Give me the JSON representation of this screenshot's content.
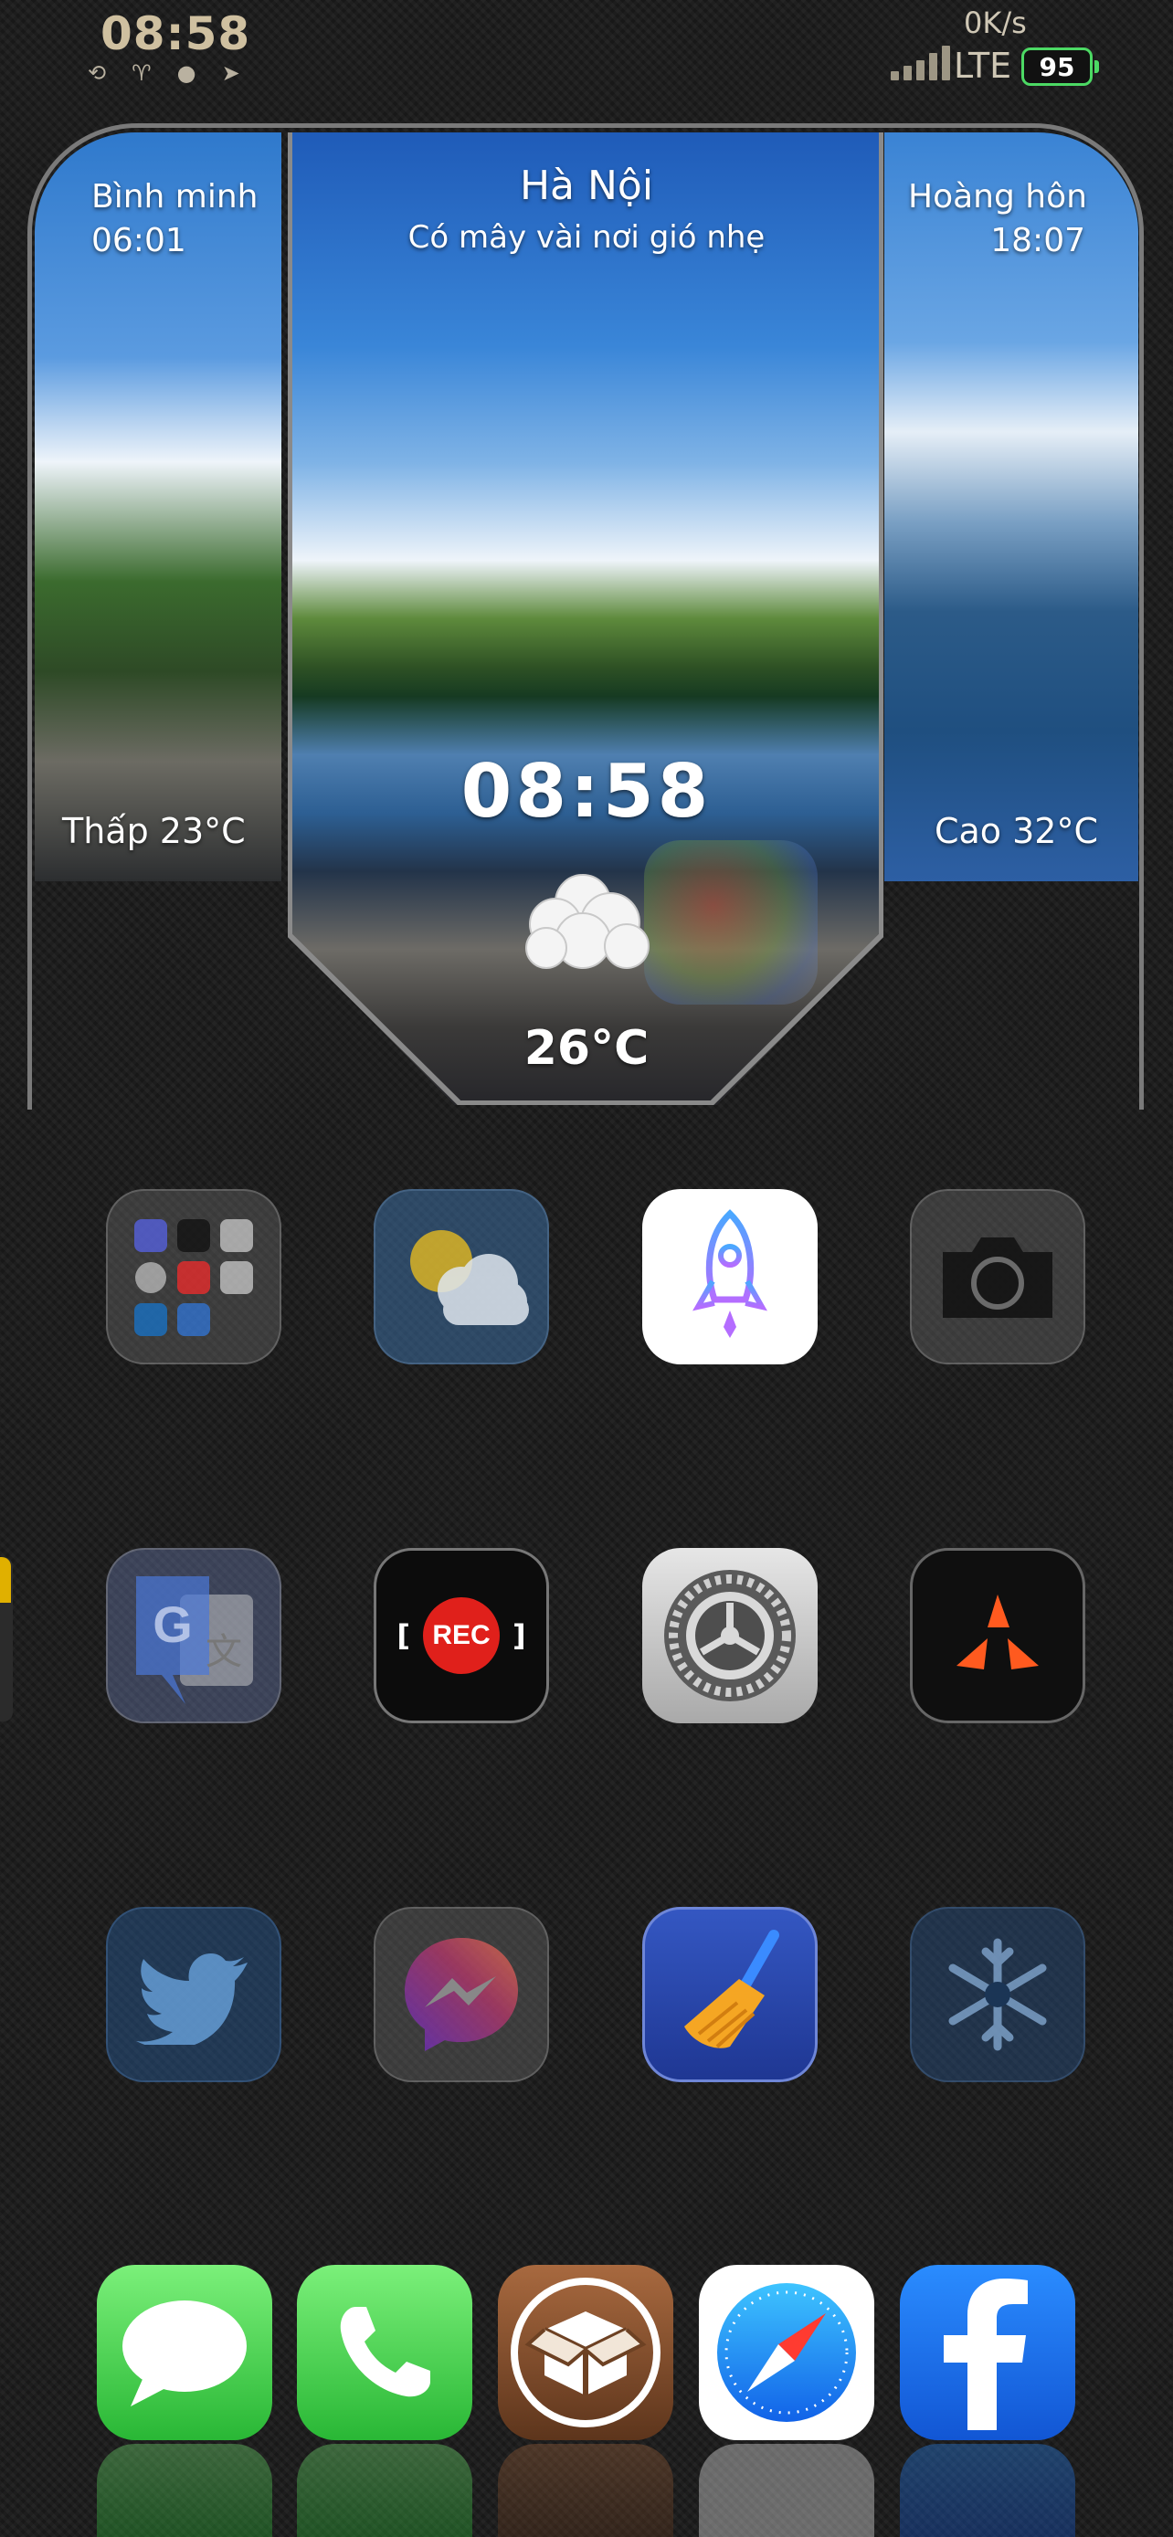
{
  "status_bar": {
    "time": "08:58",
    "net_speed": "0K/s",
    "network": "LTE",
    "battery": "95"
  },
  "widget": {
    "city": "Hà Nội",
    "condition": "Có mây vài nơi gió nhẹ",
    "sunrise_label": "Bình minh",
    "sunrise_time": "06:01",
    "sunset_label": "Hoàng hôn",
    "sunset_time": "18:07",
    "low": "Thấp 23°C",
    "high": "Cao 32°C",
    "clock": "08:58",
    "temperature": "26°C"
  },
  "rec_app": {
    "label": "REC"
  },
  "icons": {
    "grid": [
      "folder-icon",
      "weather-icon",
      "rocket-icon",
      "camera-icon",
      "translate-icon",
      "screen-recorder-icon",
      "settings-gear-icon",
      "pdf-icon",
      "twitter-bird-icon",
      "messenger-icon",
      "broom-icon",
      "snowflake-icon"
    ],
    "dock": [
      "messages-icon",
      "phone-icon",
      "cydia-icon",
      "safari-compass-icon",
      "facebook-icon"
    ]
  },
  "colors": {
    "battery": "#4cd964",
    "status_time": "#cfc0a0",
    "rec_red": "#e0201b"
  }
}
